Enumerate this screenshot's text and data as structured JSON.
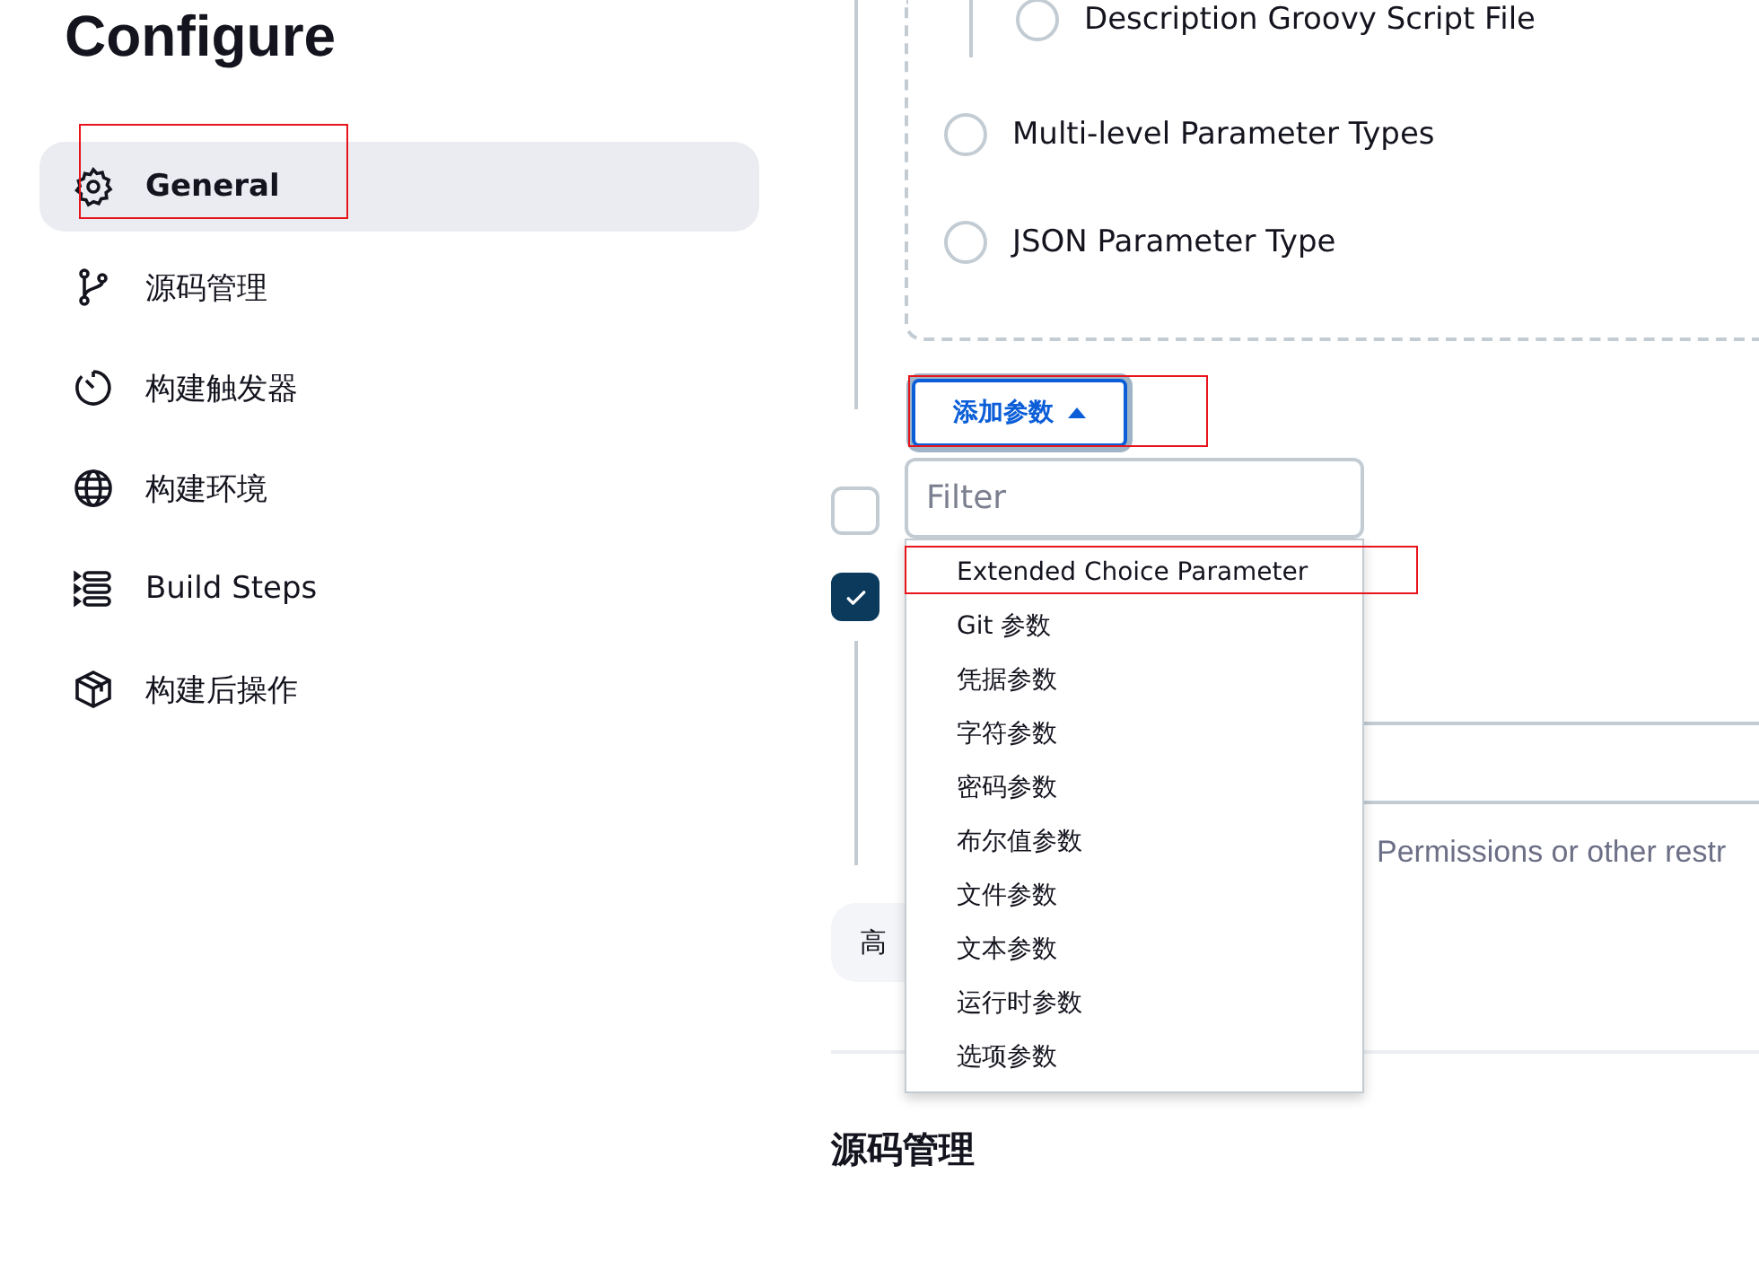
{
  "page": {
    "title": "Configure"
  },
  "sidebar": {
    "items": [
      {
        "label": "General",
        "selected": true
      },
      {
        "label": "源码管理",
        "selected": false
      },
      {
        "label": "构建触发器",
        "selected": false
      },
      {
        "label": "构建环境",
        "selected": false
      },
      {
        "label": "Build Steps",
        "selected": false
      },
      {
        "label": "构建后操作",
        "selected": false
      }
    ]
  },
  "parameter_types": {
    "options": [
      {
        "label": "Description Groovy Script File",
        "kind": "nested",
        "selected": false
      },
      {
        "label": "Multi-level Parameter Types",
        "kind": "top",
        "selected": false
      },
      {
        "label": "JSON Parameter Type",
        "kind": "top",
        "selected": false
      }
    ]
  },
  "add_parameter_button": {
    "label": "添加参数"
  },
  "filter": {
    "placeholder": "Filter"
  },
  "parameter_menu": {
    "items": [
      "Extended Choice Parameter",
      "Git 参数",
      "凭据参数",
      "字符参数",
      "密码参数",
      "布尔值参数",
      "文件参数",
      "文本参数",
      "运行时参数",
      "选项参数"
    ]
  },
  "checkboxes": [
    {
      "checked": false
    },
    {
      "checked": true
    }
  ],
  "help_text": "Permissions or other restr",
  "advanced_button": {
    "label": "高"
  },
  "section_heading": "源码管理"
}
